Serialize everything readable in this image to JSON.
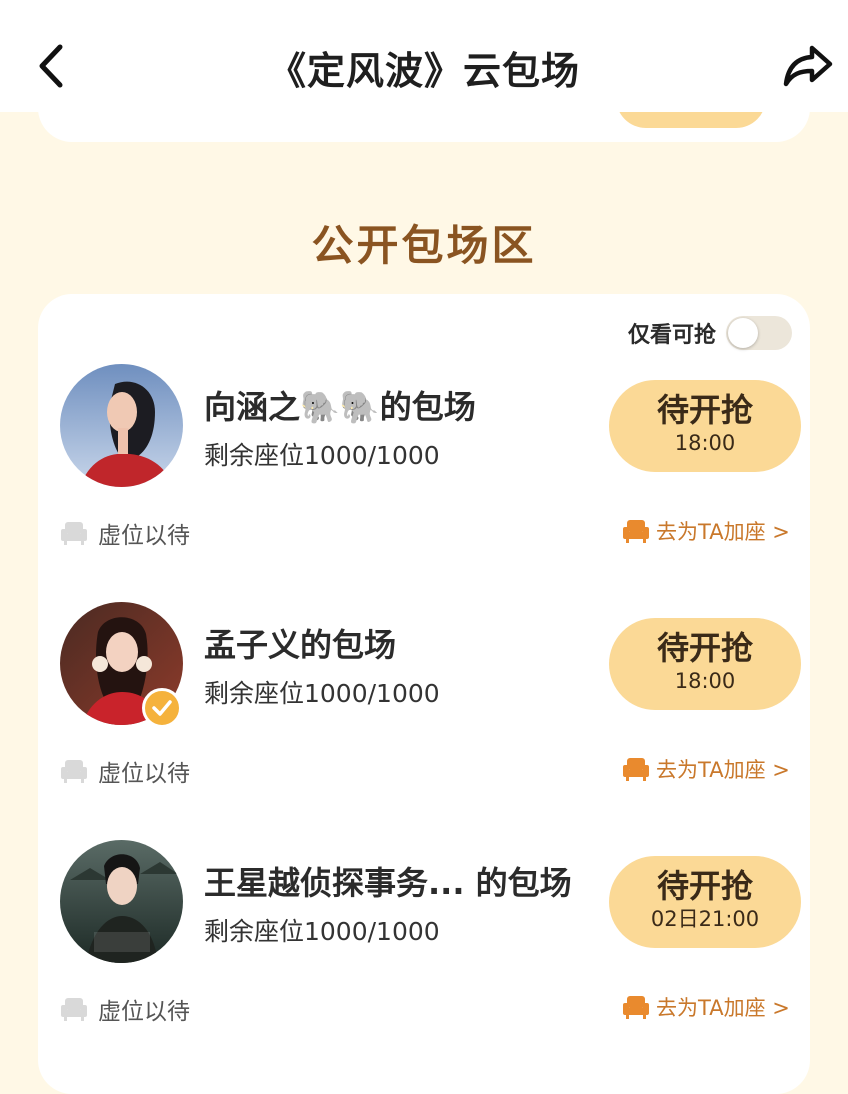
{
  "header": {
    "title": "《定风波》云包场"
  },
  "section": {
    "title": "公开包场区"
  },
  "filter": {
    "label": "仅看可抢",
    "enabled": false
  },
  "rooms": [
    {
      "name": "向涵之🐘🐘的包场",
      "seats": "剩余座位1000/1000",
      "button_label": "待开抢",
      "button_time": "18:00",
      "waiting_text": "虚位以待",
      "add_seat_text": "去为TA加座 >",
      "verified": false
    },
    {
      "name": "孟子义的包场",
      "seats": "剩余座位1000/1000",
      "button_label": "待开抢",
      "button_time": "18:00",
      "waiting_text": "虚位以待",
      "add_seat_text": "去为TA加座 >",
      "verified": true
    },
    {
      "name": "王星越侦探事务... 的包场",
      "seats": "剩余座位1000/1000",
      "button_label": "待开抢",
      "button_time": "02日21:00",
      "waiting_text": "虚位以待",
      "add_seat_text": "去为TA加座 >",
      "verified": false
    }
  ],
  "colors": {
    "accent": "#fbd996",
    "section_title": "#8a5421",
    "link": "#c9782b",
    "background": "#fff8e6"
  },
  "icons": {
    "back": "chevron-left-icon",
    "share": "share-arrow-icon",
    "seat_empty": "armchair-icon",
    "seat_add": "armchair-icon",
    "verified": "check-badge-icon"
  }
}
